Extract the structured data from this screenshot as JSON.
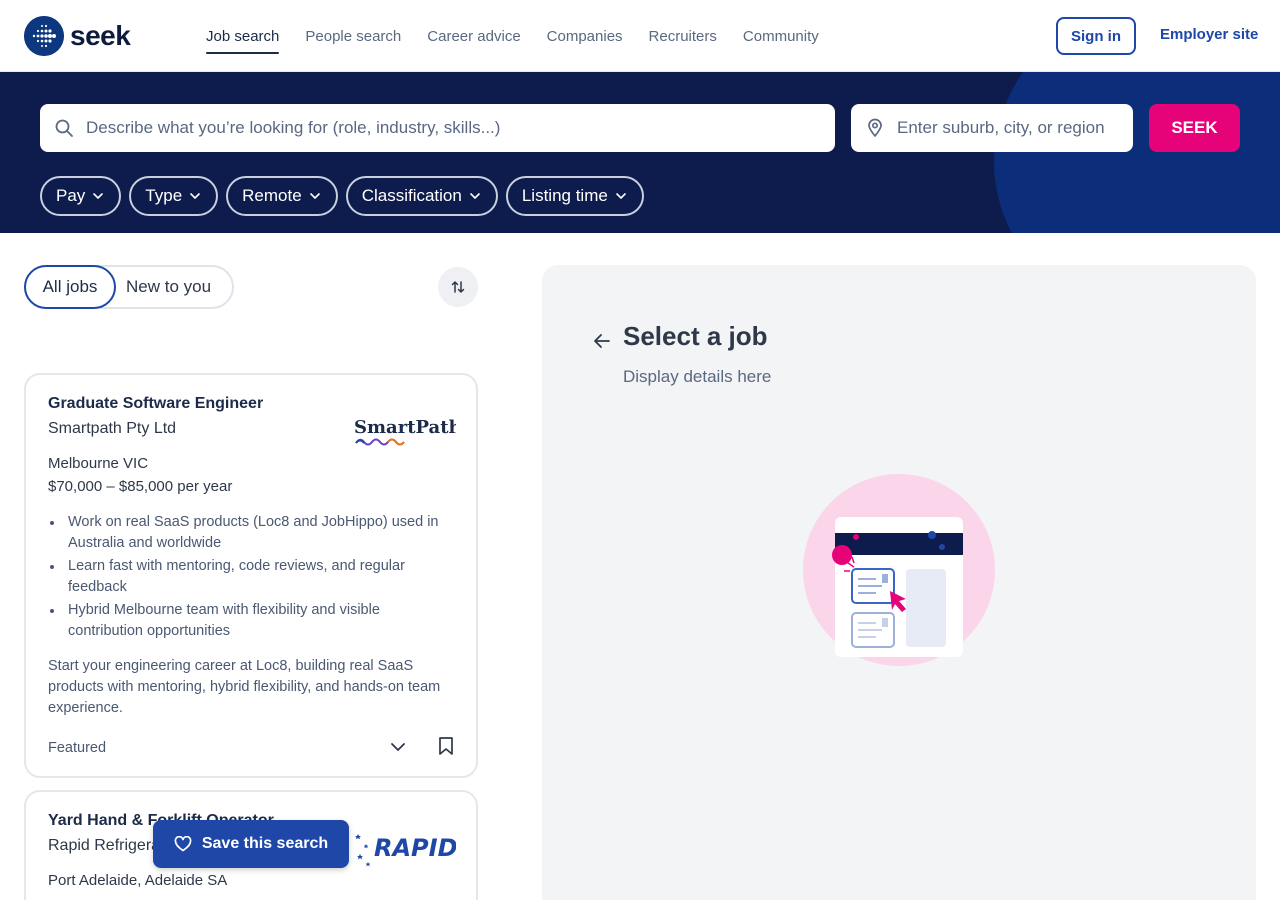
{
  "header": {
    "logo_text": "seek",
    "nav": [
      {
        "label": "Job search",
        "active": true
      },
      {
        "label": "People search",
        "active": false
      },
      {
        "label": "Career advice",
        "active": false
      },
      {
        "label": "Companies",
        "active": false
      },
      {
        "label": "Recruiters",
        "active": false
      },
      {
        "label": "Community",
        "active": false
      }
    ],
    "sign_in": "Sign in",
    "employer_site": "Employer site"
  },
  "search": {
    "keywords_placeholder": "Describe what you’re looking for (role, industry, skills...)",
    "location_placeholder": "Enter suburb, city, or region",
    "button": "SEEK",
    "filters": [
      "Pay",
      "Type",
      "Remote",
      "Classification",
      "Listing time"
    ]
  },
  "results": {
    "toggle": {
      "all": "All jobs",
      "new": "New to you"
    },
    "jobs": [
      {
        "title": "Graduate Software Engineer",
        "company": "Smartpath Pty Ltd",
        "logo_text": "SmartPath",
        "location": "Melbourne VIC",
        "pay": "$70,000 – $85,000 per year",
        "bullets": [
          "Work on real SaaS products (Loc8 and JobHippo) used in Australia and worldwide",
          "Learn fast with mentoring, code reviews, and regular feedback",
          "Hybrid Melbourne team with flexibility and visible contribution opportunities"
        ],
        "teaser": "Start your engineering career at Loc8, building real SaaS products with mentoring, hybrid flexibility, and hands-on team experience.",
        "badge": "Featured"
      },
      {
        "title": "Yard Hand & Forklift Operator",
        "company": "Rapid Refrigeration",
        "logo_text": "RAPID",
        "location": "Port Adelaide, Adelaide SA"
      }
    ],
    "save_search": "Save this search"
  },
  "detail": {
    "title": "Select a job",
    "subtitle": "Display details here"
  },
  "colors": {
    "brand_navy": "#0e1c4d",
    "brand_blue": "#1e47a8",
    "brand_pink": "#e60278",
    "panel_bg": "#f3f4f6"
  },
  "icons": [
    "search-icon",
    "location-pin-icon",
    "chevron-down-icon",
    "sort-icon",
    "bookmark-icon",
    "heart-icon",
    "back-arrow-icon"
  ]
}
